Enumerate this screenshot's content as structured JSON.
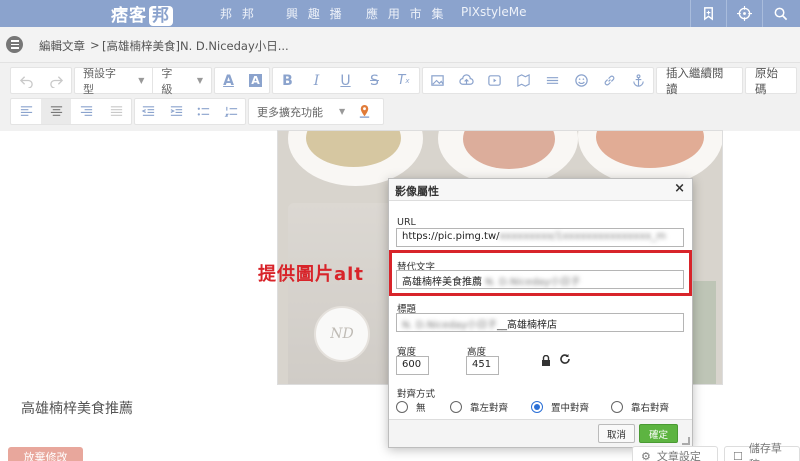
{
  "nav": {
    "logo_text": "痞客",
    "logo_tag": "邦",
    "links": [
      "邦 邦",
      "興 趣 播",
      "應 用 市 集",
      "PIXstyleMe"
    ],
    "icons": [
      "bookmark-icon",
      "target-icon",
      "search-icon"
    ]
  },
  "breadcrumb": {
    "parent": "編輯文章",
    "separator": ">",
    "current": "[高雄楠梓美食]N. D.Niceday小日..."
  },
  "toolbar": {
    "font_family": "預設字型",
    "font_size": "字級",
    "insert_more": "插入繼續閱讀",
    "source": "原始碼",
    "more_features": "更多擴充功能"
  },
  "editor": {
    "post_text": "高雄楠梓美食推薦",
    "photo_badge": "ND"
  },
  "annotation": "提供圖片alt",
  "dialog": {
    "title": "影像屬性",
    "close": "×",
    "url_label": "URL",
    "url_value": "https://pic.pimg.tw/",
    "url_blurred": "xxxxxxxxx/1xxxxxxxxxxxxxxx_m",
    "alt_label": "替代文字",
    "alt_value": "高雄楠梓美食推薦",
    "alt_blurred": "N. D.Niceday小日子",
    "title_label": "標題",
    "title_blurred": "N. D.Niceday小日子",
    "title_value": "__高雄楠梓店",
    "width_label": "寬度",
    "width_value": "600",
    "height_label": "高度",
    "height_value": "451",
    "align_label": "對齊方式",
    "align_options": [
      "無",
      "靠左對齊",
      "置中對齊",
      "靠右對齊"
    ],
    "align_selected": "置中對齊",
    "cancel": "取消",
    "ok": "確定"
  },
  "footer": {
    "discard": "放棄修改",
    "article_settings": "文章設定",
    "save_draft": "儲存草稿"
  },
  "colors": {
    "nav": "#8ba3cd",
    "annotation": "#d8242a",
    "ok_button": "#5db441",
    "discard": "#e8a79c"
  }
}
